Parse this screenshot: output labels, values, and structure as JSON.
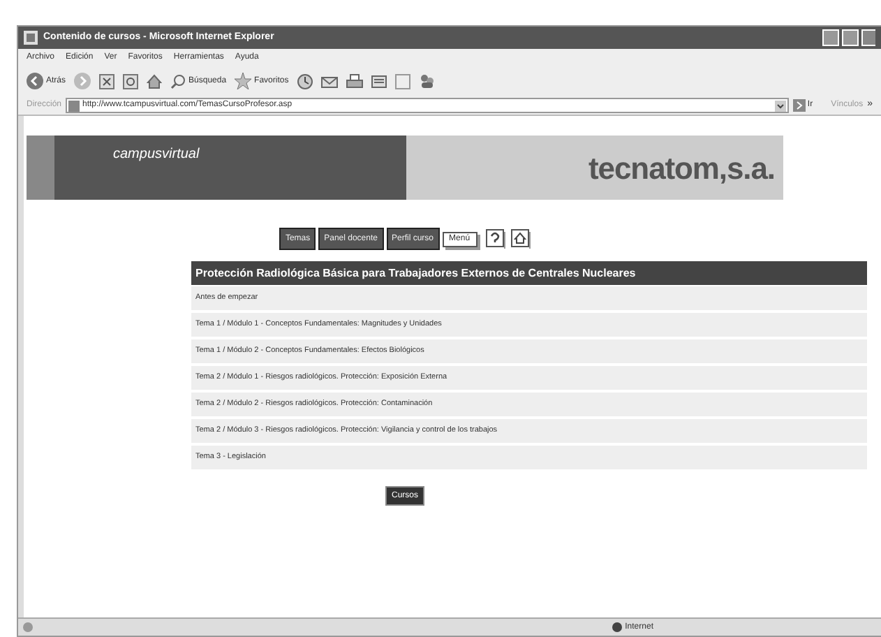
{
  "window": {
    "title": "Contenido de cursos - Microsoft Internet Explorer"
  },
  "menu": [
    "Archivo",
    "Edición",
    "Ver",
    "Favoritos",
    "Herramientas",
    "Ayuda"
  ],
  "toolbar": {
    "back": "Atrás",
    "search": "Búsqueda",
    "favorites": "Favoritos"
  },
  "address_bar": {
    "label": "Dirección",
    "value": "http://www.tcampusvirtual.com/TemasCursoProfesor.asp",
    "go": "Ir",
    "links": "Vínculos",
    "more": "»"
  },
  "banner": {
    "logo": "campusvirtual",
    "company": "tecnatom,s.a."
  },
  "nav": [
    {
      "label": "Temas",
      "kind": "dark"
    },
    {
      "label": "Panel docente",
      "kind": "dark"
    },
    {
      "label": "Perfil curso",
      "kind": "dark"
    },
    {
      "label": "Menú",
      "kind": "light"
    }
  ],
  "course": {
    "title": "Protección Radiológica Básica para Trabajadores Externos de Centrales Nucleares",
    "topics": [
      "Antes de empezar",
      "Tema 1 / Módulo 1 - Conceptos Fundamentales: Magnitudes y Unidades",
      "Tema 1 / Módulo 2 - Conceptos Fundamentales: Efectos Biológicos",
      "Tema 2 / Módulo 1 - Riesgos radiológicos. Protección: Exposición Externa",
      "Tema 2 / Módulo 2 - Riesgos radiológicos. Protección: Contaminación",
      "Tema 2 / Módulo 3 - Riesgos radiológicos. Protección: Vigilancia y control de los trabajos",
      "Tema 3 - Legislación"
    ]
  },
  "courses_button": "Cursos",
  "status_bar": {
    "zone": "Internet"
  }
}
